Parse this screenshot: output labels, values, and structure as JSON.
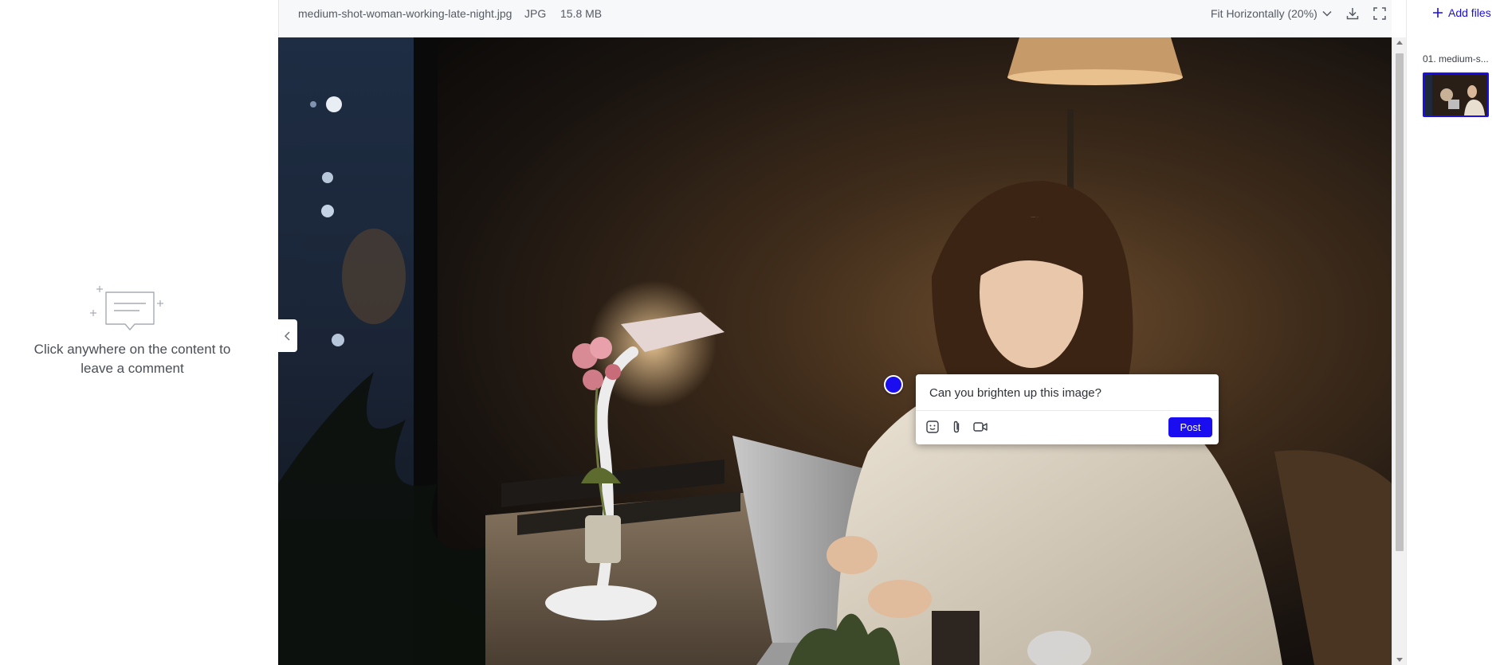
{
  "comments_panel": {
    "empty_text": "Click anywhere on the content to leave a comment"
  },
  "topbar": {
    "file_name": "medium-shot-woman-working-late-night.jpg",
    "file_type": "JPG",
    "file_size": "15.8 MB",
    "zoom_label": "Fit Horizontally (20%)"
  },
  "comment": {
    "text": "Can you brighten up this image?",
    "post_label": "Post"
  },
  "files_panel": {
    "add_files_label": "Add files",
    "items": [
      {
        "label": "01. medium-s..."
      }
    ]
  },
  "colors": {
    "accent": "#1a0df0"
  }
}
